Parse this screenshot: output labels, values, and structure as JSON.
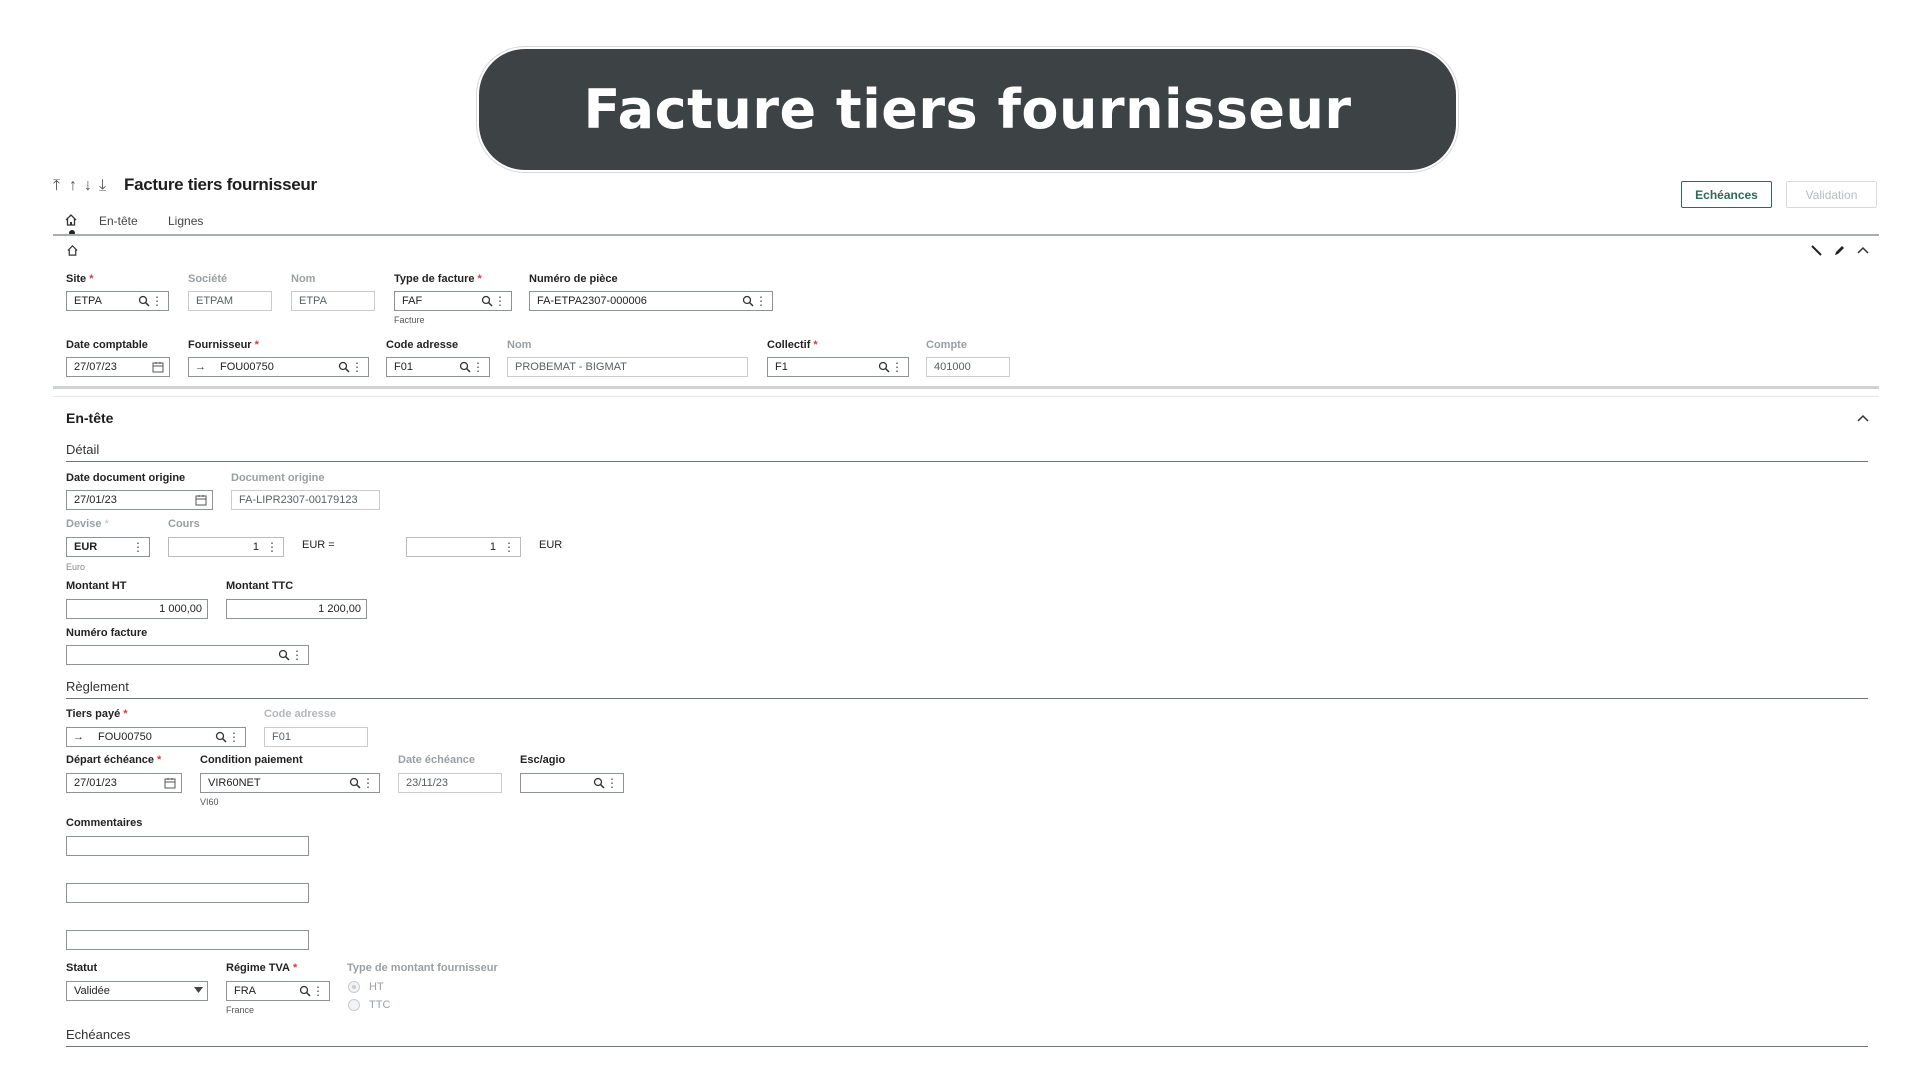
{
  "banner": {
    "title": "Facture tiers fournisseur"
  },
  "header": {
    "title": "Facture tiers fournisseur",
    "nav_icons": [
      "first-icon",
      "previous-icon",
      "next-icon",
      "last-icon"
    ],
    "buttons": {
      "echeances": "Echéances",
      "validation": "Validation"
    }
  },
  "tabs": {
    "home_icon": "home-icon",
    "entete": "En-tête",
    "lignes": "Lignes"
  },
  "top": {
    "site": {
      "label": "Site",
      "value": "ETPA"
    },
    "societe": {
      "label": "Société",
      "value": "ETPAM"
    },
    "nom1": {
      "label": "Nom",
      "value": "ETPA"
    },
    "type_facture": {
      "label": "Type de facture",
      "value": "FAF",
      "sub": "Facture"
    },
    "numero_piece": {
      "label": "Numéro de pièce",
      "value": "FA-ETPA2307-000006"
    },
    "date_comptable": {
      "label": "Date comptable",
      "value": "27/07/23"
    },
    "fournisseur": {
      "label": "Fournisseur",
      "value": "FOU00750"
    },
    "code_adresse": {
      "label": "Code adresse",
      "value": "F01"
    },
    "nom2": {
      "label": "Nom",
      "value": "PROBEMAT - BIGMAT"
    },
    "collectif": {
      "label": "Collectif",
      "value": "F1"
    },
    "compte": {
      "label": "Compte",
      "value": "401000"
    }
  },
  "entete": {
    "title": "En-tête",
    "detail": {
      "title": "Détail",
      "date_doc_origine": {
        "label": "Date document origine",
        "value": "27/01/23"
      },
      "doc_origine": {
        "label": "Document origine",
        "value": "FA-LIPR2307-00179123"
      },
      "devise": {
        "label": "Devise",
        "value": "EUR",
        "sub": "Euro"
      },
      "cours": {
        "label": "Cours",
        "value": "1"
      },
      "eur_eq": "EUR =",
      "cours2": "1",
      "eur_after": "EUR",
      "montant_ht": {
        "label": "Montant HT",
        "value": "1 000,00"
      },
      "montant_ttc": {
        "label": "Montant TTC",
        "value": "1 200,00"
      },
      "numero_facture": {
        "label": "Numéro facture",
        "value": ""
      }
    },
    "reglement": {
      "title": "Règlement",
      "tiers_paye": {
        "label": "Tiers payé",
        "value": "FOU00750"
      },
      "code_adresse": {
        "label": "Code adresse",
        "value": "F01"
      },
      "depart_echeance": {
        "label": "Départ échéance",
        "value": "27/01/23"
      },
      "condition_paiement": {
        "label": "Condition paiement",
        "value": "VIR60NET",
        "sub": "VI60"
      },
      "date_echeance": {
        "label": "Date échéance",
        "value": "23/11/23"
      },
      "esc_agio": {
        "label": "Esc/agio",
        "value": ""
      },
      "commentaires": {
        "label": "Commentaires",
        "lines": [
          "",
          "",
          ""
        ]
      },
      "statut": {
        "label": "Statut",
        "value": "Validée"
      },
      "regime_tva": {
        "label": "Régime TVA",
        "value": "FRA",
        "sub": "France"
      },
      "type_montant": {
        "label": "Type de montant fournisseur",
        "options": [
          "HT",
          "TTC"
        ],
        "selected": "HT"
      }
    },
    "echeances": {
      "title": "Echéances"
    }
  }
}
